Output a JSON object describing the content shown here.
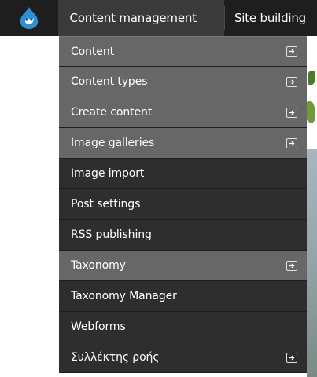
{
  "topbar": {
    "logo_icon": "drupal-drop-icon",
    "active_label": "Content management",
    "next_label": "Site building"
  },
  "menu": {
    "items": [
      {
        "label": "Content",
        "has_submenu": true,
        "style": "light"
      },
      {
        "label": "Content types",
        "has_submenu": true,
        "style": "light"
      },
      {
        "label": "Create content",
        "has_submenu": true,
        "style": "light"
      },
      {
        "label": "Image galleries",
        "has_submenu": true,
        "style": "light"
      },
      {
        "label": "Image import",
        "has_submenu": false,
        "style": "dark"
      },
      {
        "label": "Post settings",
        "has_submenu": false,
        "style": "dark"
      },
      {
        "label": "RSS publishing",
        "has_submenu": false,
        "style": "dark"
      },
      {
        "label": "Taxonomy",
        "has_submenu": true,
        "style": "light"
      },
      {
        "label": "Taxonomy Manager",
        "has_submenu": false,
        "style": "dark"
      },
      {
        "label": "Webforms",
        "has_submenu": false,
        "style": "dark"
      },
      {
        "label": "Συλλέκτης ροής",
        "has_submenu": true,
        "style": "dark"
      }
    ],
    "submenu_icon": "arrow-right-box-icon"
  },
  "colors": {
    "topbar_bg": "#1e1e1e",
    "menu_light": "#676767",
    "menu_dark": "#2e2e2e"
  }
}
